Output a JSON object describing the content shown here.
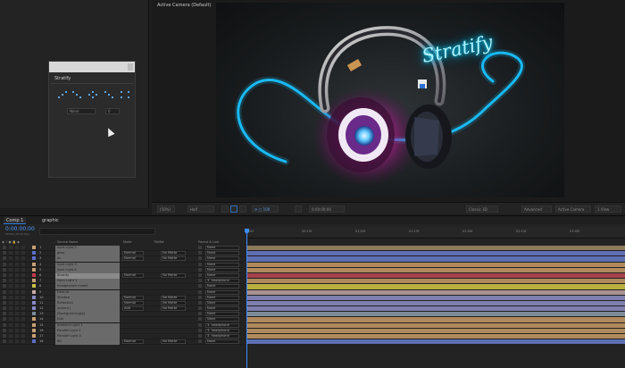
{
  "left_panel": {
    "stratify_panel": {
      "header": "Stratify",
      "dropdowns": [
        "None",
        "0"
      ]
    }
  },
  "viewer": {
    "title": "Active Camera (Default)",
    "neon_text": "Stratify",
    "toolbar": {
      "zoom": "(50%)",
      "resolution": "Half",
      "timecode": "0:00:00:00",
      "renderer": "Classic 3D",
      "view_mode": "Advanced",
      "camera": "Active Camera",
      "views": "1 View"
    }
  },
  "timeline": {
    "tabs": [
      "Comp 1",
      "graphic"
    ],
    "timecode": "0:00:00:00",
    "timecode_sub": "00000 (30.00 fps)",
    "columns": {
      "source_name": "Source Name",
      "mode": "Mode",
      "trkmat": "TrkMat",
      "parent": "Parent & Link"
    },
    "ruler_ticks": [
      "00f",
      "00:15f",
      "01:00f",
      "01:15f",
      "02:00f",
      "02:15f",
      "03:00f"
    ],
    "layers": [
      {
        "num": "1",
        "name": "Spot Light 2",
        "mode": "",
        "trkmat": "",
        "parent": "None",
        "color": "#c8a070",
        "track": "#8d7a5c"
      },
      {
        "num": "2",
        "name": "glow",
        "mode": "Normal",
        "trkmat": "No Matte",
        "parent": "None",
        "color": "#5b6ec9",
        "track": "#5e6fb2"
      },
      {
        "num": "3",
        "name": "bc",
        "mode": "Normal",
        "trkmat": "No Matte",
        "parent": "None",
        "color": "#5b6ec9",
        "track": "#5e6fb2"
      },
      {
        "num": "4",
        "name": "Spot Light 3",
        "mode": "",
        "trkmat": "",
        "parent": "None",
        "color": "#c8a070",
        "track": "#b08a5c"
      },
      {
        "num": "5",
        "name": "Spot Light 4",
        "mode": "",
        "trkmat": "",
        "parent": "None",
        "color": "#c8a070",
        "track": "#b08a5c"
      },
      {
        "num": "6",
        "name": "Stratify",
        "mode": "Normal",
        "trkmat": "No Matte",
        "parent": "None",
        "color": "#c8384b",
        "track": "#a5424a"
      },
      {
        "num": "7",
        "name": "Point Light 1",
        "mode": "",
        "trkmat": "",
        "parent": "3. headphone",
        "color": "#c8a070",
        "track": "#b08a5c"
      },
      {
        "num": "8",
        "name": "headphones model",
        "mode": "",
        "trkmat": "",
        "parent": "None",
        "color": "#c9c34a",
        "track": "#b8b040"
      },
      {
        "num": "9",
        "name": "Default",
        "mode": "",
        "trkmat": "",
        "parent": "None",
        "color": "#c9a9a4",
        "track": "#a89290"
      },
      {
        "num": "10",
        "name": "Shadow",
        "mode": "Normal",
        "trkmat": "No Matte",
        "parent": "None",
        "color": "#8a8ac4",
        "track": "#7f7fae"
      },
      {
        "num": "11",
        "name": "Reflection",
        "mode": "Normal",
        "trkmat": "No Matte",
        "parent": "None",
        "color": "#8a8ac4",
        "track": "#7f7fae"
      },
      {
        "num": "12",
        "name": "scratch]",
        "mode": "Add",
        "trkmat": "No Matte",
        "parent": "None",
        "color": "#8a8ac4",
        "track": "#7f7fae"
      },
      {
        "num": "13",
        "name": "[Background.jpg]",
        "mode": "",
        "trkmat": "",
        "parent": "None",
        "color": "#7a8a9a",
        "track": "#7d8b98"
      },
      {
        "num": "14",
        "name": "Null",
        "mode": "",
        "trkmat": "",
        "parent": "None",
        "color": "#c8a070",
        "track": "#b08a5c"
      },
      {
        "num": "15",
        "name": "Ambient Light 1",
        "mode": "",
        "trkmat": "",
        "parent": "3. headphone",
        "color": "#c8a070",
        "track": "#b08a5c"
      },
      {
        "num": "16",
        "name": "Parallel Light 2",
        "mode": "",
        "trkmat": "",
        "parent": "3. headphone",
        "color": "#c8a070",
        "track": "#b08a5c"
      },
      {
        "num": "17",
        "name": "Parallel Light 3",
        "mode": "",
        "trkmat": "",
        "parent": "3. headphone",
        "color": "#c8a070",
        "track": "#b08a5c"
      },
      {
        "num": "18",
        "name": "BG",
        "mode": "Normal",
        "trkmat": "No Matte",
        "parent": "None",
        "color": "#5b6ec9",
        "track": "#5e6fb2"
      }
    ]
  }
}
